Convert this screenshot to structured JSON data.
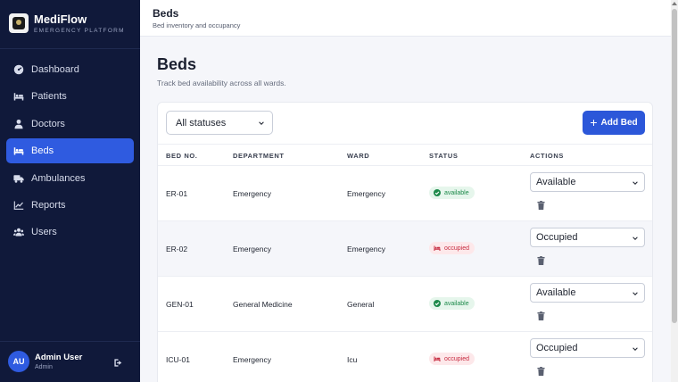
{
  "sidebar": {
    "brand_name": "MediFlow",
    "brand_sub": "EMERGENCY PLATFORM",
    "items": [
      {
        "label": "Dashboard",
        "icon": "dashboard-icon"
      },
      {
        "label": "Patients",
        "icon": "bed-icon"
      },
      {
        "label": "Doctors",
        "icon": "doctor-icon"
      },
      {
        "label": "Beds",
        "icon": "bed-icon",
        "active": true
      },
      {
        "label": "Ambulances",
        "icon": "ambulance-icon"
      },
      {
        "label": "Reports",
        "icon": "chart-icon"
      },
      {
        "label": "Users",
        "icon": "users-icon"
      }
    ],
    "user": {
      "initials": "AU",
      "name": "Admin User",
      "role": "Admin"
    }
  },
  "header": {
    "title": "Beds",
    "subtitle": "Bed inventory and occupancy"
  },
  "main": {
    "title": "Beds",
    "subtitle": "Track bed availability across all wards.",
    "filter_value": "All statuses",
    "add_button": "Add Bed",
    "columns": [
      "BED NO.",
      "DEPARTMENT",
      "WARD",
      "STATUS",
      "ACTIONS"
    ],
    "rows": [
      {
        "bed": "ER-01",
        "department": "Emergency",
        "ward": "Emergency",
        "status": "available",
        "action": "Available"
      },
      {
        "bed": "ER-02",
        "department": "Emergency",
        "ward": "Emergency",
        "status": "occupied",
        "action": "Occupied"
      },
      {
        "bed": "GEN-01",
        "department": "General Medicine",
        "ward": "General",
        "status": "available",
        "action": "Available"
      },
      {
        "bed": "ICU-01",
        "department": "Emergency",
        "ward": "Icu",
        "status": "occupied",
        "action": "Occupied"
      }
    ]
  },
  "colors": {
    "sidebar": "#10193a",
    "accent": "#2f5be0",
    "available": "#1d8a4a",
    "occupied": "#c62a3f"
  }
}
